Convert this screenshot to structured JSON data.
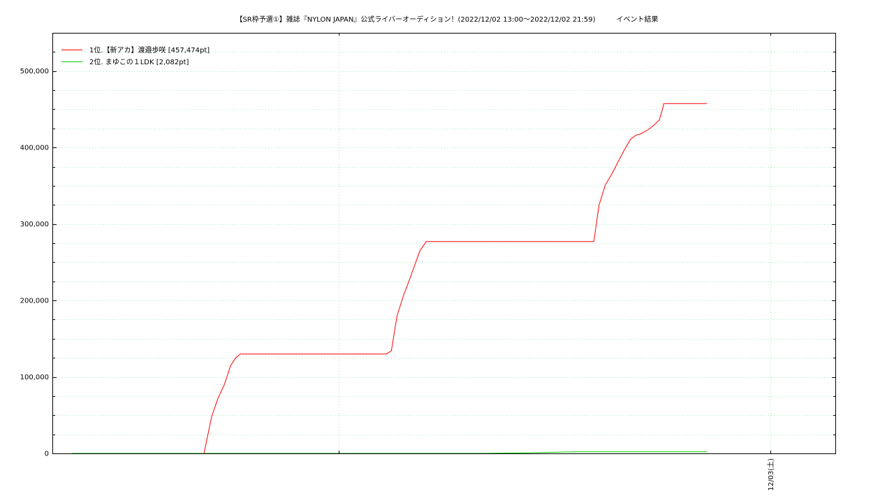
{
  "chart_data": {
    "type": "line",
    "title": "【SR枠予選①】雑誌『NYLON JAPAN』公式ライバーオーディション！(2022/12/02 13:00〜2022/12/02 21:59)　　　イベント結果",
    "xlabel": "",
    "ylabel": "",
    "x_unit": "hours since 2022/12/02 13:00",
    "xlim": [
      0,
      12
    ],
    "ylim": [
      0,
      550000
    ],
    "y_ticks": [
      0,
      100000,
      200000,
      300000,
      400000,
      500000
    ],
    "y_tick_labels": [
      "0",
      "100,000",
      "200,000",
      "300,000",
      "400,000",
      "500,000"
    ],
    "x_ticks": [
      11
    ],
    "x_tick_labels": [
      "12/03(土)"
    ],
    "grid": true,
    "legend_position": "top-left",
    "series": [
      {
        "name": "1位.【新アカ】渡邉歩咲 [457,474pt]",
        "color": "#ff0000",
        "x": [
          0,
          2.08,
          2.2,
          2.3,
          2.4,
          2.5,
          2.58,
          2.65,
          2.75,
          4.95,
          5.03,
          5.12,
          5.22,
          5.32,
          5.48,
          5.58,
          6.12,
          8.22,
          8.3,
          8.4,
          8.5,
          8.6,
          8.7,
          8.8,
          8.88,
          8.96,
          9.05,
          9.15,
          9.25,
          9.3,
          9.32,
          9.35,
          10.0
        ],
        "y": [
          0,
          0,
          48000,
          72000,
          90000,
          115000,
          125000,
          130000,
          130000,
          130000,
          134000,
          180000,
          206000,
          228000,
          265000,
          277000,
          277000,
          277000,
          324000,
          351000,
          365000,
          381000,
          397000,
          411000,
          416000,
          418000,
          422000,
          428000,
          436000,
          450000,
          457474,
          457474,
          457474
        ]
      },
      {
        "name": "2位. まゆこの１LDK [2,082pt]",
        "color": "#00cc00",
        "x": [
          0,
          6.5,
          7.2,
          7.9,
          10.0
        ],
        "y": [
          0,
          0,
          800,
          2082,
          2082
        ]
      }
    ]
  }
}
